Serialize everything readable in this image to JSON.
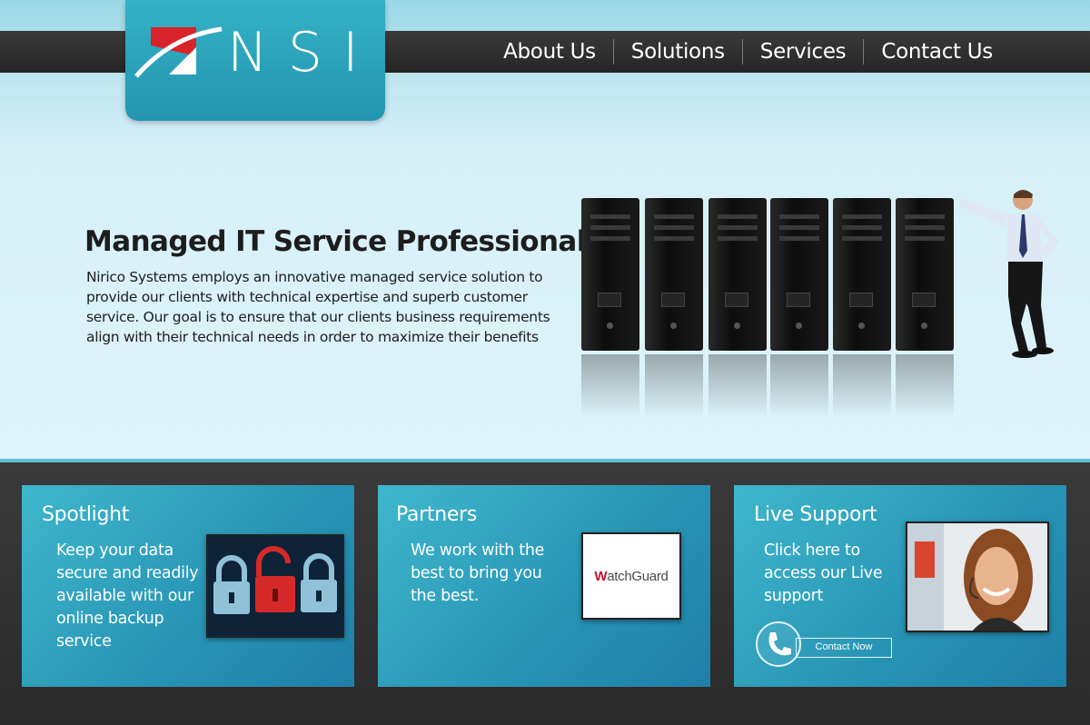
{
  "logo": {
    "text": "NSI"
  },
  "nav": {
    "items": [
      {
        "label": "About Us"
      },
      {
        "label": "Solutions"
      },
      {
        "label": "Services"
      },
      {
        "label": "Contact Us"
      }
    ]
  },
  "hero": {
    "title": "Managed IT Service Professionals",
    "description": "Nirico Systems employs an innovative managed service solution to provide our clients with technical expertise and superb customer service. Our goal is to ensure that our clients business requirements align with their technical needs in order to maximize their benefits"
  },
  "cards": [
    {
      "title": "Spotlight",
      "text": "Keep your data secure and readily available with our online backup service",
      "image": "security-locks-icon"
    },
    {
      "title": "Partners",
      "text": "We work with the best to bring you the best.",
      "image_text": "WatchGuard"
    },
    {
      "title": "Live Support",
      "text": "Click here to access our Live support",
      "button_label": "Contact Now",
      "image": "support-agent-photo"
    }
  ],
  "colors": {
    "accent": "#2aa0b8",
    "nav_bg": "#2b2b2b",
    "lock_red": "#d62a2a",
    "watchguard_red": "#c8102e"
  }
}
